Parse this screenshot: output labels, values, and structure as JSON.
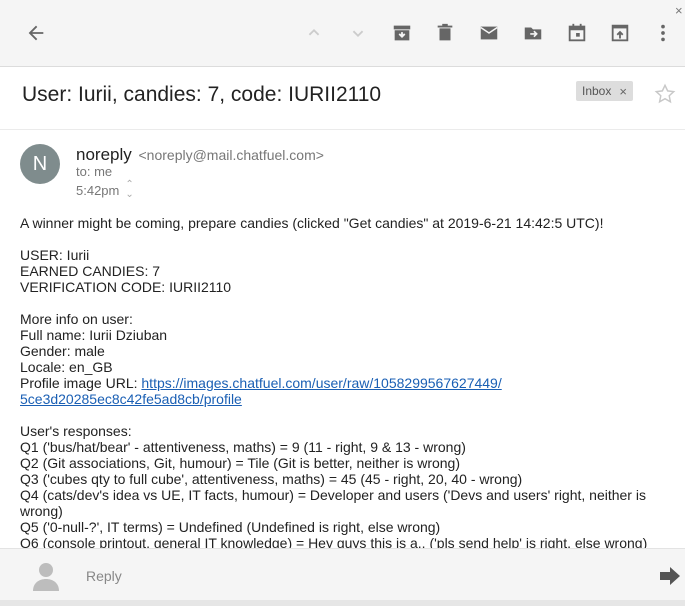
{
  "subject": "User: Iurii, candies: 7, code: IURII2110",
  "label": {
    "name": "Inbox",
    "remove": "×"
  },
  "sender": {
    "initial": "N",
    "name": "noreply",
    "email": "<noreply@mail.chatfuel.com>",
    "to": "to: me",
    "time": "5:42pm"
  },
  "body": {
    "intro": "A winner might be coming, prepare candies (clicked \"Get candies\" at 2019-6-21 14:42:5 UTC)!",
    "user": "USER: Iurii",
    "earned": "EARNED CANDIES: 7",
    "code": "VERIFICATION CODE: IURII2110",
    "more_info": "More info on user:",
    "full_name": "Full name: Iurii Dziuban",
    "gender": "Gender: male",
    "locale": "Locale: en_GB",
    "profile_label": "Profile image URL: ",
    "profile_url_line1": "https://images.chatfuel.com/user/raw/1058299567627449/",
    "profile_url_line2": "5ce3d20285ec8c42fe5ad8cb/profile",
    "responses_header": "User's responses:",
    "q1": "Q1 ('bus/hat/bear' - attentiveness, maths) = 9 (11 - right, 9 & 13 - wrong)",
    "q2": "Q2 (Git associations, Git, humour) = Tile (Git is better, neither is wrong)",
    "q3": "Q3 ('cubes qty to full cube', attentiveness, maths) = 45 (45 - right, 20, 40 - wrong)",
    "q4": "Q4 (cats/dev's idea vs UE, IT facts, humour) = Developer and users ('Devs and users' right, neither is wrong)",
    "q5": "Q5 ('0-null-?', IT terms) = Undefined (Undefined is right, else wrong)",
    "q6": "Q6 (console printout, general IT knowledge) = Hey guys this is a.. ('pls send help' is right, else wrong)"
  },
  "reply": {
    "placeholder": "Reply"
  },
  "icons": {
    "back": "arrow-left-icon",
    "prev": "chevron-up-icon",
    "next": "chevron-down-icon",
    "archive": "archive-icon",
    "delete": "trash-icon",
    "mark": "mail-icon",
    "move": "move-to-icon",
    "snooze": "calendar-icon",
    "open": "open-in-new-icon",
    "more": "more-vert-icon",
    "star": "star-icon",
    "send": "send-arrow-icon"
  },
  "colors": {
    "link": "#1a5fb4",
    "avatar_bg": "#7f8c8d",
    "toolbar_bg": "#f5f5f5"
  }
}
